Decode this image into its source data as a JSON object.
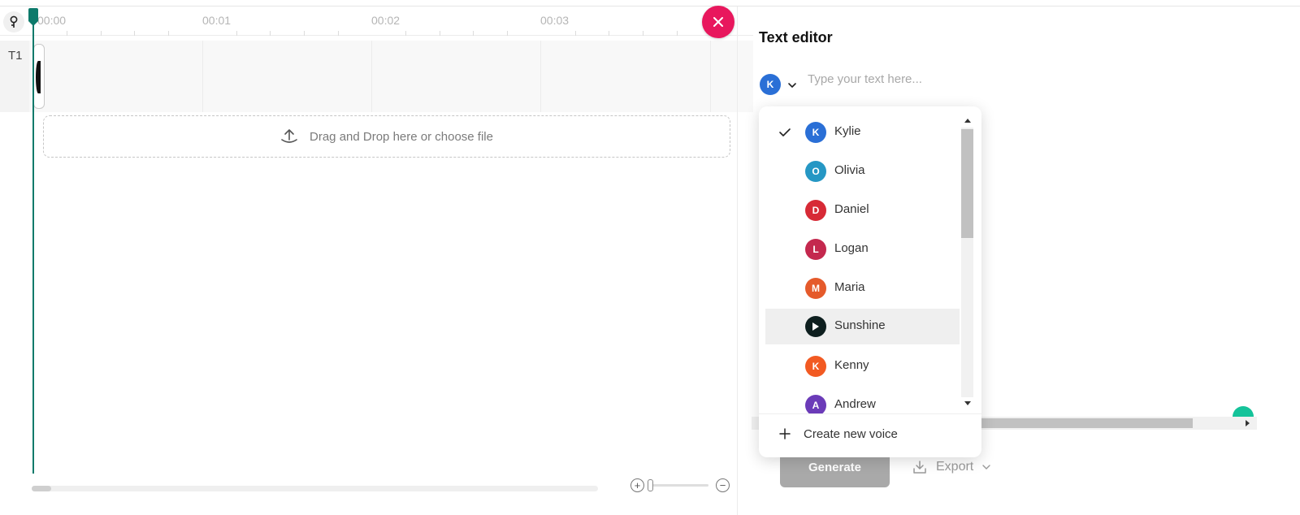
{
  "timeline": {
    "ruler_labels": [
      "00:00",
      "00:01",
      "00:02",
      "00:03"
    ],
    "track_label": "T1",
    "dropzone_text": "Drag and Drop here or choose file"
  },
  "editor": {
    "title": "Text editor",
    "selected_voice_initial": "K",
    "text_placeholder": "Type your text here...",
    "generate_label": "Generate",
    "export_label": "Export"
  },
  "voice_dropdown": {
    "items": [
      {
        "label": "Kylie",
        "initial": "K",
        "color": "#2a6fd6",
        "selected": true
      },
      {
        "label": "Olivia",
        "initial": "O",
        "color": "#2597c4",
        "selected": false
      },
      {
        "label": "Daniel",
        "initial": "D",
        "color": "#d72a36",
        "selected": false
      },
      {
        "label": "Logan",
        "initial": "L",
        "color": "#c4284e",
        "selected": false
      },
      {
        "label": "Maria",
        "initial": "M",
        "color": "#e55a2b",
        "selected": false
      },
      {
        "label": "Sunshine",
        "initial": "",
        "color": "#0e1f1f",
        "selected": false,
        "playing": true
      },
      {
        "label": "Kenny",
        "initial": "K",
        "color": "#f25a22",
        "selected": false
      },
      {
        "label": "Andrew",
        "initial": "A",
        "color": "#6b3bb8",
        "selected": false
      }
    ],
    "create_label": "Create new voice"
  },
  "colors": {
    "playhead": "#0d7a6b",
    "close_button": "#e8175d",
    "generate_disabled": "#a9a9a9"
  }
}
